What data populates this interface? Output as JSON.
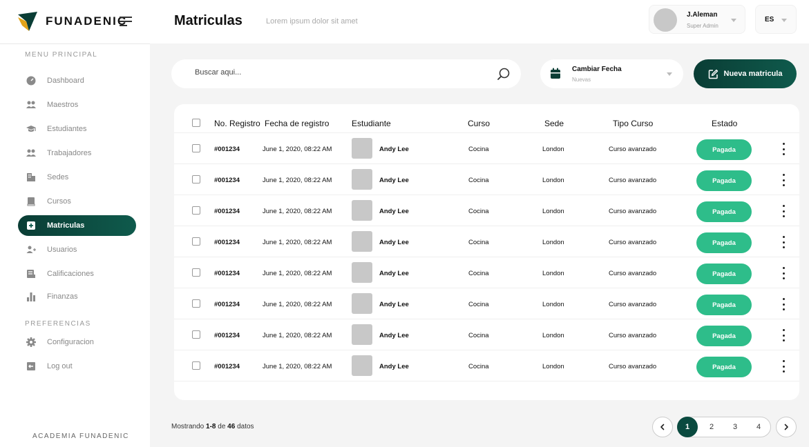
{
  "brand": {
    "name": "FUNADENIC",
    "footer": "ACADEMIA FUNADENIC"
  },
  "sidebar": {
    "main_heading": "MENU PRINCIPAL",
    "prefs_heading": "PREFERENCIAS",
    "items": [
      {
        "label": "Dashboard",
        "icon": "dashboard-icon"
      },
      {
        "label": "Maestros",
        "icon": "people-icon"
      },
      {
        "label": "Estudiantes",
        "icon": "graduation-cap-icon"
      },
      {
        "label": "Trabajadores",
        "icon": "people-icon"
      },
      {
        "label": "Sedes",
        "icon": "building-icon"
      },
      {
        "label": "Cursos",
        "icon": "book-icon"
      },
      {
        "label": "Matriculas",
        "icon": "plus-square-icon",
        "active": true
      },
      {
        "label": "Usuarios",
        "icon": "add-user-icon"
      },
      {
        "label": "Calificaciones",
        "icon": "grades-icon"
      },
      {
        "label": "Finanzas",
        "icon": "bar-chart-icon"
      }
    ],
    "pref_items": [
      {
        "label": "Configuracion",
        "icon": "gear-icon"
      },
      {
        "label": "Log out",
        "icon": "logout-icon"
      }
    ]
  },
  "header": {
    "title": "Matriculas",
    "subtitle": "Lorem ipsum  dolor sit amet",
    "user_name": "J.Aleman",
    "user_role": "Super Admin",
    "language": "ES"
  },
  "toolbar": {
    "search_placeholder": "Buscar aqui...",
    "date_title": "Cambiar Fecha",
    "date_sub": "Nuevas",
    "new_button": "Nueva matricula"
  },
  "table": {
    "headers": [
      "No. Registro",
      "Fecha de registro",
      "Estudiante",
      "Curso",
      "Sede",
      "Tipo Curso",
      "Estado"
    ],
    "rows": [
      {
        "id": "#001234",
        "date": "June 1, 2020, 08:22 AM",
        "student": "Andy Lee",
        "course": "Cocina",
        "site": "London",
        "type": "Curso avanzado",
        "status": "Pagada"
      },
      {
        "id": "#001234",
        "date": "June 1, 2020, 08:22 AM",
        "student": "Andy Lee",
        "course": "Cocina",
        "site": "London",
        "type": "Curso avanzado",
        "status": "Pagada"
      },
      {
        "id": "#001234",
        "date": "June 1, 2020, 08:22 AM",
        "student": "Andy Lee",
        "course": "Cocina",
        "site": "London",
        "type": "Curso avanzado",
        "status": "Pagada"
      },
      {
        "id": "#001234",
        "date": "June 1, 2020, 08:22 AM",
        "student": "Andy Lee",
        "course": "Cocina",
        "site": "London",
        "type": "Curso avanzado",
        "status": "Pagada"
      },
      {
        "id": "#001234",
        "date": "June 1, 2020, 08:22 AM",
        "student": "Andy Lee",
        "course": "Cocina",
        "site": "London",
        "type": "Curso avanzado",
        "status": "Pagada"
      },
      {
        "id": "#001234",
        "date": "June 1, 2020, 08:22 AM",
        "student": "Andy Lee",
        "course": "Cocina",
        "site": "London",
        "type": "Curso avanzado",
        "status": "Pagada"
      },
      {
        "id": "#001234",
        "date": "June 1, 2020, 08:22 AM",
        "student": "Andy Lee",
        "course": "Cocina",
        "site": "London",
        "type": "Curso avanzado",
        "status": "Pagada"
      },
      {
        "id": "#001234",
        "date": "June 1, 2020, 08:22 AM",
        "student": "Andy Lee",
        "course": "Cocina",
        "site": "London",
        "type": "Curso avanzado",
        "status": "Pagada"
      }
    ]
  },
  "footer": {
    "showing_prefix": "Mostrando",
    "showing_range": "1-8",
    "showing_mid": "de",
    "showing_total": "46",
    "showing_suffix": "datos",
    "pages": [
      "1",
      "2",
      "3",
      "4"
    ],
    "current_page": "1",
    "prev_icon": "chevron-left-icon",
    "next_icon": "chevron-right-icon"
  },
  "colors": {
    "brand_dark": "#0a3d35",
    "success": "#2ebd8a"
  }
}
